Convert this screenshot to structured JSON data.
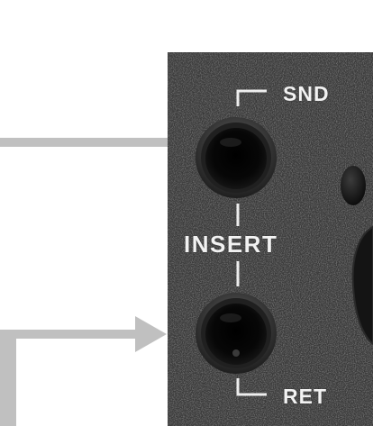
{
  "labels": {
    "send": "SND",
    "insert": "INSERT",
    "return": "RET"
  },
  "colors": {
    "panel": "#3a3a3a",
    "panel_speckle": "#5a5a5a",
    "label_text": "#f2f2f2",
    "arrow": "#c0c0c0",
    "background": "#ffffff"
  },
  "icons": {
    "send_jack": "quarter-inch-jack-socket",
    "return_jack": "quarter-inch-jack-socket",
    "return_arrow": "arrow-right"
  }
}
